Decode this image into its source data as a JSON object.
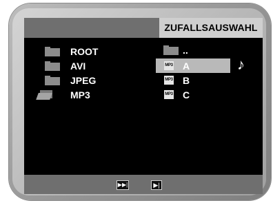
{
  "header": {
    "mode_label": "ZUFALLSAUSWAHL"
  },
  "folders": [
    {
      "label": "ROOT",
      "icon": "folder-icon"
    },
    {
      "label": "AVI",
      "icon": "folder-icon"
    },
    {
      "label": "JPEG",
      "icon": "folder-icon"
    },
    {
      "label": "MP3",
      "icon": "open-folder-icon"
    }
  ],
  "files": [
    {
      "label": "..",
      "type": "parent",
      "icon": "folder-icon"
    },
    {
      "label": "A",
      "type": "mp3",
      "badge": "MP3",
      "selected": true,
      "playing": true
    },
    {
      "label": "B",
      "type": "mp3",
      "badge": "MP3"
    },
    {
      "label": "C",
      "type": "mp3",
      "badge": "MP3"
    }
  ],
  "now_playing_symbol": "♪",
  "controls": {
    "next_symbol": "▶▶|",
    "step_symbol": "▶|"
  },
  "colors": {
    "screen_bg": "#000000",
    "bar_bg": "#6f6f6f",
    "header_label_bg": "#cfcfcf",
    "selection_bg": "#b9b9b9"
  }
}
